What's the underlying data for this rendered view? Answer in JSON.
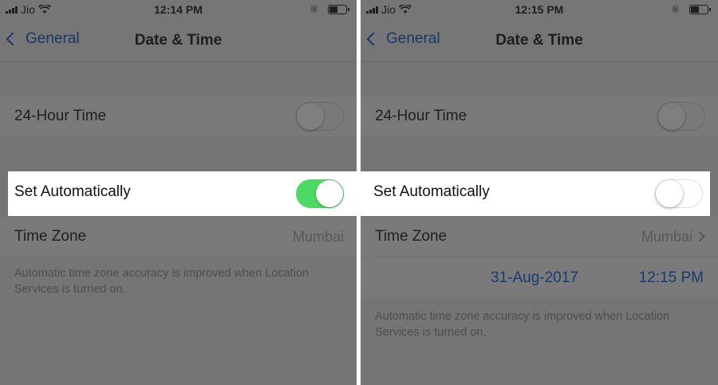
{
  "left": {
    "status": {
      "carrier": "Jio",
      "time": "12:14 PM"
    },
    "nav": {
      "back_label": "General",
      "title": "Date & Time"
    },
    "rows": {
      "twenty_four_hour": {
        "label": "24-Hour Time",
        "state": "off"
      },
      "set_automatically": {
        "label": "Set Automatically",
        "state": "on"
      },
      "time_zone": {
        "label": "Time Zone",
        "value": "Mumbai"
      }
    },
    "footer": "Automatic time zone accuracy is improved when Location Services is turned on."
  },
  "right": {
    "status": {
      "carrier": "Jio",
      "time": "12:15 PM"
    },
    "nav": {
      "back_label": "General",
      "title": "Date & Time"
    },
    "rows": {
      "twenty_four_hour": {
        "label": "24-Hour Time",
        "state": "off"
      },
      "set_automatically": {
        "label": "Set Automatically",
        "state": "off"
      },
      "time_zone": {
        "label": "Time Zone",
        "value": "Mumbai"
      },
      "date_time": {
        "date": "31-Aug-2017",
        "time": "12:15 PM"
      }
    },
    "footer": "Automatic time zone accuracy is improved when Location Services is turned on."
  },
  "colors": {
    "toggle_on": "#4cd964",
    "link_blue": "#007aff",
    "dim_overlay": "#757575"
  },
  "icons": [
    "signal-bars-icon",
    "wifi-icon",
    "bluetooth-icon",
    "battery-icon",
    "chevron-left-icon",
    "chevron-right-icon"
  ]
}
